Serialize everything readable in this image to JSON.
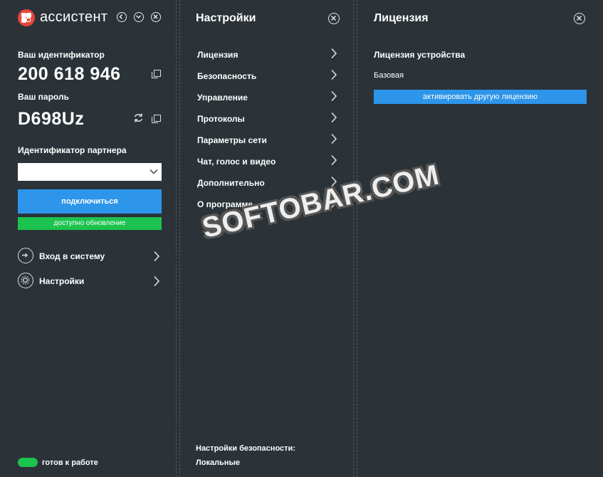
{
  "app": {
    "name": "ассистент",
    "colors": {
      "background": "#2b3338",
      "accent": "#2d95ea",
      "success": "#1cc34e",
      "logo": "#e8453c"
    }
  },
  "left_panel": {
    "id_label": "Ваш идентификатор",
    "id_value": "200 618 946",
    "password_label": "Ваш пароль",
    "password_value": "D698Uz",
    "partner_label": "Идентификатор партнера",
    "partner_value": "",
    "connect_label": "подключиться",
    "update_label": "доступно обновление",
    "nav": [
      {
        "label": "Вход в систему",
        "icon": "login-icon"
      },
      {
        "label": "Настройки",
        "icon": "gear-icon"
      }
    ],
    "status": "готов к работе"
  },
  "settings_panel": {
    "title": "Настройки",
    "items": [
      {
        "label": "Лицензия"
      },
      {
        "label": "Безопасность"
      },
      {
        "label": "Управление"
      },
      {
        "label": "Протоколы"
      },
      {
        "label": "Параметры сети"
      },
      {
        "label": "Чат, голос и видео"
      },
      {
        "label": "Дополнительно"
      },
      {
        "label": "О программе"
      }
    ],
    "security_label": "Настройки безопасности:",
    "security_value": "Локальные"
  },
  "license_panel": {
    "title": "Лицензия",
    "device_license_label": "Лицензия устройства",
    "license_type": "Базовая",
    "activate_label": "активировать другую лицензию"
  },
  "watermark": "SOFTOBAR.COM"
}
